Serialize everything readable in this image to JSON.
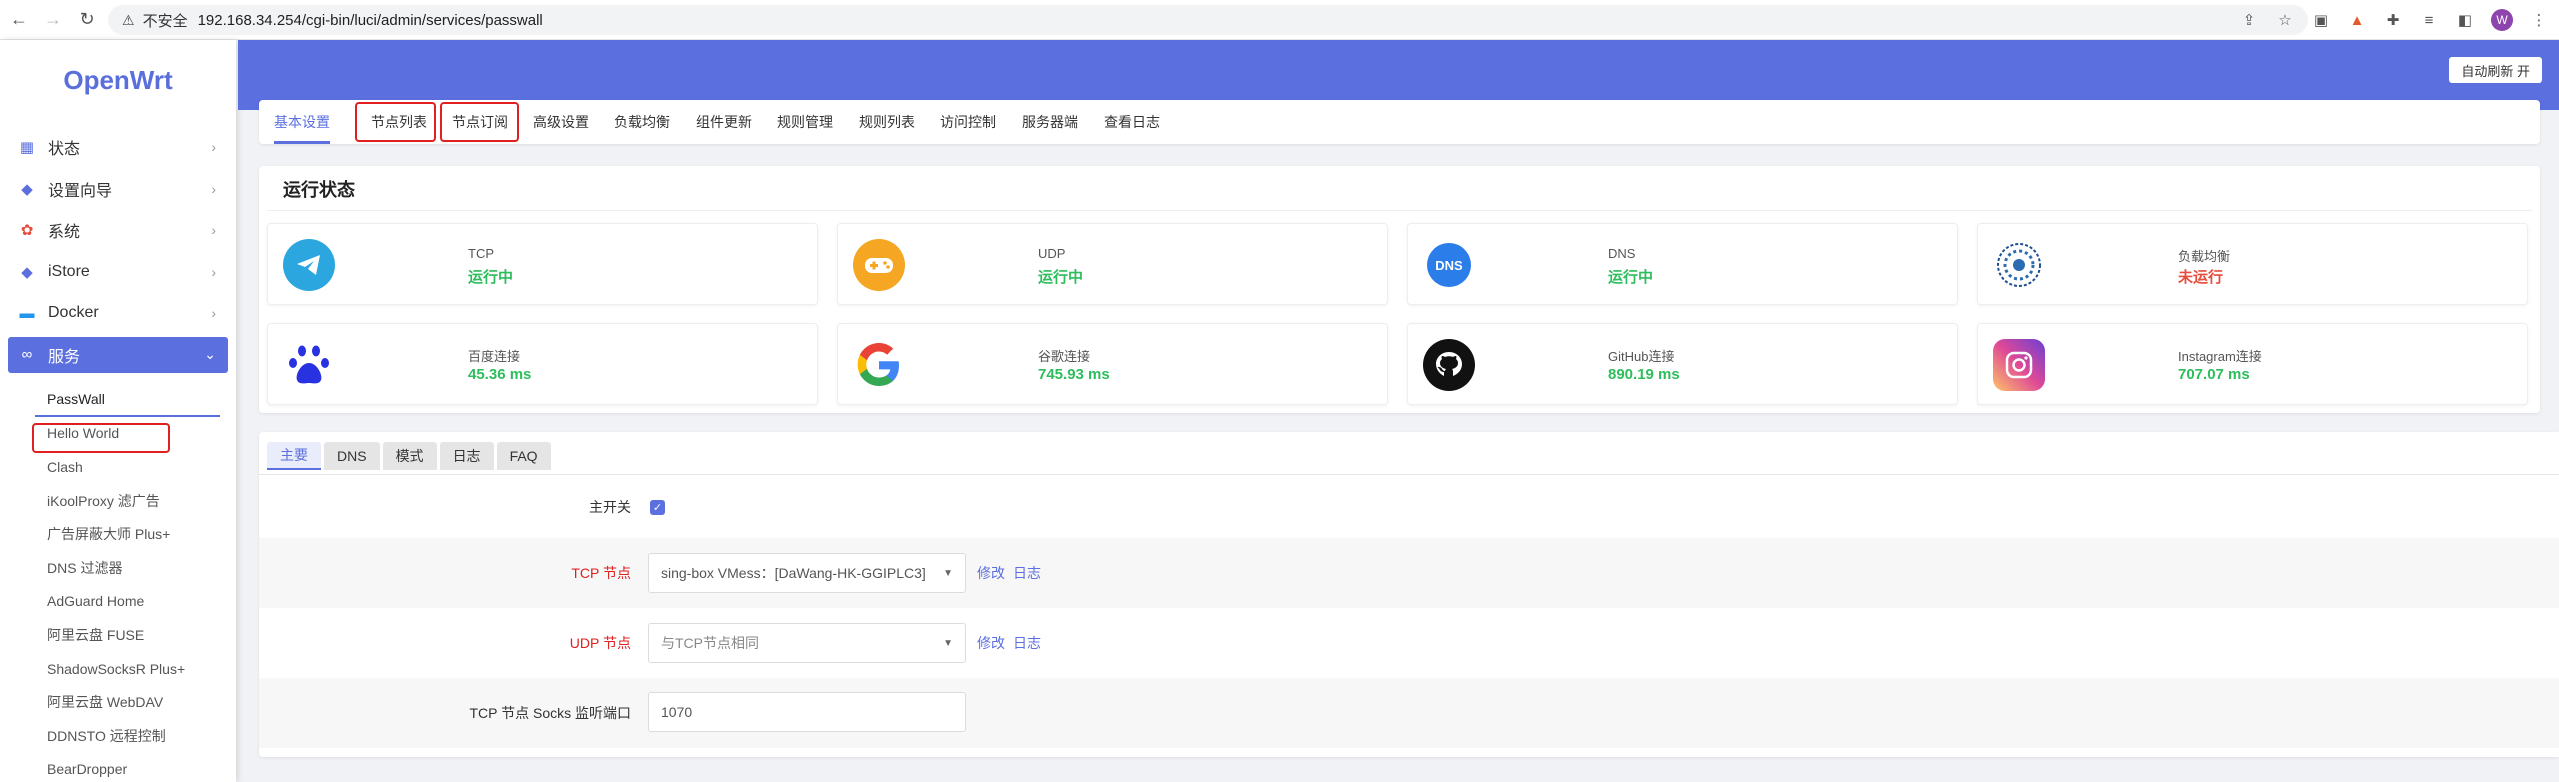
{
  "browser": {
    "insecure_label": "不安全",
    "url": "192.168.34.254/cgi-bin/luci/admin/services/passwall",
    "avatar_letter": "W"
  },
  "sidebar": {
    "logo": "OpenWrt",
    "menu": [
      {
        "label": "状态",
        "icon": "dashboard-icon"
      },
      {
        "label": "设置向导",
        "icon": "cube-icon"
      },
      {
        "label": "系统",
        "icon": "gear-icon"
      },
      {
        "label": "iStore",
        "icon": "cube-icon"
      },
      {
        "label": "Docker",
        "icon": "docker-icon"
      },
      {
        "label": "服务",
        "icon": "link-icon"
      }
    ],
    "services_submenu": [
      "PassWall",
      "Hello World",
      "Clash",
      "iKoolProxy 滤广告",
      "广告屏蔽大师 Plus+",
      "DNS 过滤器",
      "AdGuard Home",
      "阿里云盘 FUSE",
      "ShadowSocksR Plus+",
      "阿里云盘 WebDAV",
      "DDNSTO 远程控制",
      "BearDropper"
    ]
  },
  "header": {
    "refresh_button": "自动刷新 开"
  },
  "tabs": [
    "基本设置",
    "节点列表",
    "节点订阅",
    "高级设置",
    "负载均衡",
    "组件更新",
    "规则管理",
    "规则列表",
    "访问控制",
    "服务器端",
    "查看日志"
  ],
  "status": {
    "title": "运行状态",
    "cards": [
      {
        "label": "TCP",
        "value": "运行中",
        "icon": "telegram-icon"
      },
      {
        "label": "UDP",
        "value": "运行中",
        "icon": "gamepad-icon"
      },
      {
        "label": "DNS",
        "value": "运行中",
        "icon": "dns-icon"
      },
      {
        "label": "负载均衡",
        "value": "未运行",
        "icon": "haproxy-icon"
      },
      {
        "label": "百度连接",
        "value": "45.36 ms",
        "icon": "baidu-icon"
      },
      {
        "label": "谷歌连接",
        "value": "745.93 ms",
        "icon": "google-icon"
      },
      {
        "label": "GitHub连接",
        "value": "890.19 ms",
        "icon": "github-icon"
      },
      {
        "label": "Instagram连接",
        "value": "707.07 ms",
        "icon": "instagram-icon"
      }
    ],
    "dns_badge": "DNS"
  },
  "settings": {
    "subtabs": [
      "主要",
      "DNS",
      "模式",
      "日志",
      "FAQ"
    ],
    "main_switch_label": "主开关",
    "main_switch_checked": true,
    "tcp_node_label": "TCP 节点",
    "tcp_node_value": "sing-box VMess：[DaWang-HK-GGIPLC3]",
    "udp_node_label": "UDP 节点",
    "udp_node_value": "与TCP节点相同",
    "edit_link": "修改",
    "log_link": "日志",
    "socks_port_label": "TCP 节点 Socks 监听端口",
    "socks_port_value": "1070"
  },
  "colors": {
    "accent": "#5b6fde",
    "running": "#2dbd5c",
    "stopped": "#e74c3c",
    "highlight": "#e02020"
  }
}
